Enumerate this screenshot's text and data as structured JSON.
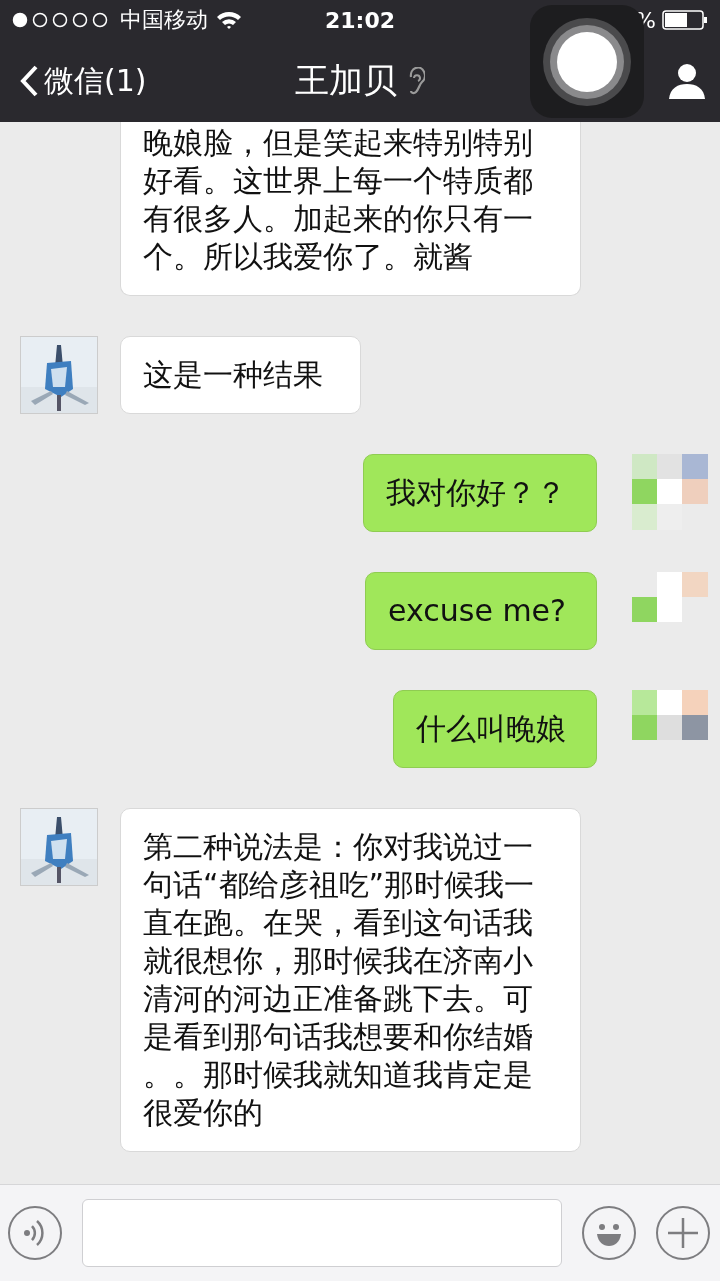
{
  "status_bar": {
    "carrier": "中国移动",
    "time": "21:02",
    "battery_text": "%"
  },
  "nav": {
    "back": "微信(1)",
    "title": "王加贝"
  },
  "messages": [
    {
      "kind": "received",
      "cut_top": true,
      "text": "晚娘脸，但是笑起来特别特别好看。这世界上每一个特质都有很多人。加起来的你只有一个。所以我爱你了。就酱"
    },
    {
      "kind": "received",
      "cut_top": false,
      "text": "这是一种结果"
    },
    {
      "kind": "sent",
      "cut_top": false,
      "text": "我对你好？？"
    },
    {
      "kind": "sent",
      "cut_top": false,
      "text": "excuse me?"
    },
    {
      "kind": "sent",
      "cut_top": false,
      "text": "什么叫晚娘"
    },
    {
      "kind": "received",
      "cut_top": false,
      "text": "第二种说法是：你对我说过一句话“都给彦祖吃”那时候我一直在跑。在哭，看到这句话我就很想你，那时候我在济南小清河的河边正准备跳下去。可是看到那句话我想要和你结婚。。那时候我就知道我肯定是很爱你的"
    }
  ]
}
